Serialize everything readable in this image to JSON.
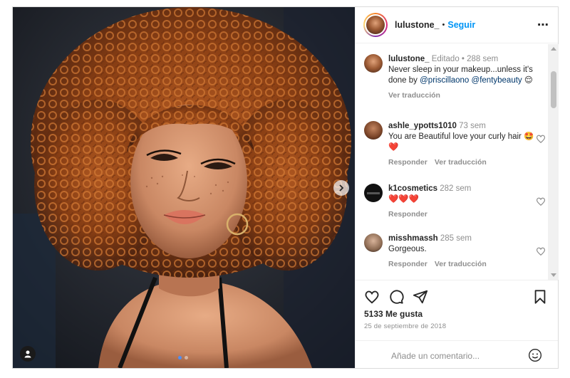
{
  "post": {
    "username": "lulustone_",
    "separator": "•",
    "follow_label": "Seguir",
    "more_icon": "⋯",
    "carousel": {
      "current_index": 1,
      "total": 2
    }
  },
  "comments": [
    {
      "username": "lulustone_",
      "meta": "Editado • 288 sem",
      "text_before": "Never sleep in your makeup...unless it's done by ",
      "mention1": "@priscillaono",
      "mention2": "@fentybeauty",
      "emoji": "😌",
      "translate_label": "Ver traducción"
    },
    {
      "username": "ashle_ypotts1010",
      "meta": "73 sem",
      "text": "You are Beautiful love your curly hair 🤩❤️",
      "reply_label": "Responder",
      "translate_label": "Ver traducción"
    },
    {
      "username": "k1cosmetics",
      "meta": "282 sem",
      "text": "❤️❤️❤️",
      "reply_label": "Responder"
    },
    {
      "username": "misshmassh",
      "meta": "285 sem",
      "text": "Gorgeous.",
      "reply_label": "Responder",
      "translate_label": "Ver traducción"
    }
  ],
  "footer": {
    "likes": "5133 Me gusta",
    "date": "25 de septiembre de 2018",
    "comment_placeholder": "Añade un comentario..."
  },
  "colors": {
    "link_blue": "#0095f6",
    "mention_blue": "#00376b",
    "muted": "#8e8e8e",
    "heart_red": "#ed4956"
  }
}
